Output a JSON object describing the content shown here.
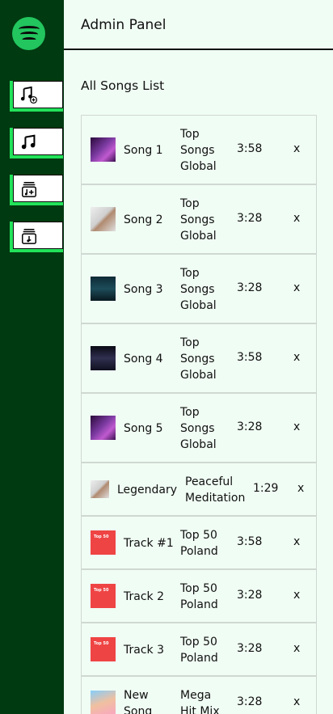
{
  "sidebar": {
    "logo_icon": "spotify-logo-icon",
    "buttons": [
      {
        "name": "add-song-button",
        "icon": "music-note-plus-icon"
      },
      {
        "name": "list-songs-button",
        "icon": "music-note-icon"
      },
      {
        "name": "add-album-button",
        "icon": "album-add-icon"
      },
      {
        "name": "list-albums-button",
        "icon": "album-list-icon"
      }
    ]
  },
  "header": {
    "title": "Admin Panel"
  },
  "main": {
    "section_title": "All Songs List"
  },
  "songs": [
    {
      "name_lines": [
        "Song 1"
      ],
      "album_lines": [
        "Top",
        "Songs",
        "Global"
      ],
      "duration": "3:58",
      "delete": "x"
    },
    {
      "name_lines": [
        "Song 2"
      ],
      "album_lines": [
        "Top",
        "Songs",
        "Global"
      ],
      "duration": "3:28",
      "delete": "x"
    },
    {
      "name_lines": [
        "Song 3"
      ],
      "album_lines": [
        "Top",
        "Songs",
        "Global"
      ],
      "duration": "3:28",
      "delete": "x"
    },
    {
      "name_lines": [
        "Song 4"
      ],
      "album_lines": [
        "Top",
        "Songs",
        "Global"
      ],
      "duration": "3:58",
      "delete": "x"
    },
    {
      "name_lines": [
        "Song 5"
      ],
      "album_lines": [
        "Top",
        "Songs",
        "Global"
      ],
      "duration": "3:28",
      "delete": "x"
    },
    {
      "name_lines": [
        "Legendary"
      ],
      "album_lines": [
        "Peaceful",
        "Meditation"
      ],
      "duration": "1:29",
      "delete": "x"
    },
    {
      "name_lines": [
        "Track #1"
      ],
      "album_lines": [
        "Top 50",
        "Poland"
      ],
      "duration": "3:58",
      "delete": "x",
      "thumb_text": "Top 50"
    },
    {
      "name_lines": [
        "Track 2"
      ],
      "album_lines": [
        "Top 50",
        "Poland"
      ],
      "duration": "3:28",
      "delete": "x",
      "thumb_text": "Top 50"
    },
    {
      "name_lines": [
        "Track 3"
      ],
      "album_lines": [
        "Top 50",
        "Poland"
      ],
      "duration": "3:28",
      "delete": "x",
      "thumb_text": "Top 50"
    },
    {
      "name_lines": [
        "New",
        "Song"
      ],
      "album_lines": [
        "Mega",
        "Hit Mix"
      ],
      "duration": "3:28",
      "delete": "x"
    }
  ],
  "colors": {
    "sidebar_bg": "#003a10",
    "accent_green": "#22e35a",
    "page_bg": "#f0fdf4"
  }
}
